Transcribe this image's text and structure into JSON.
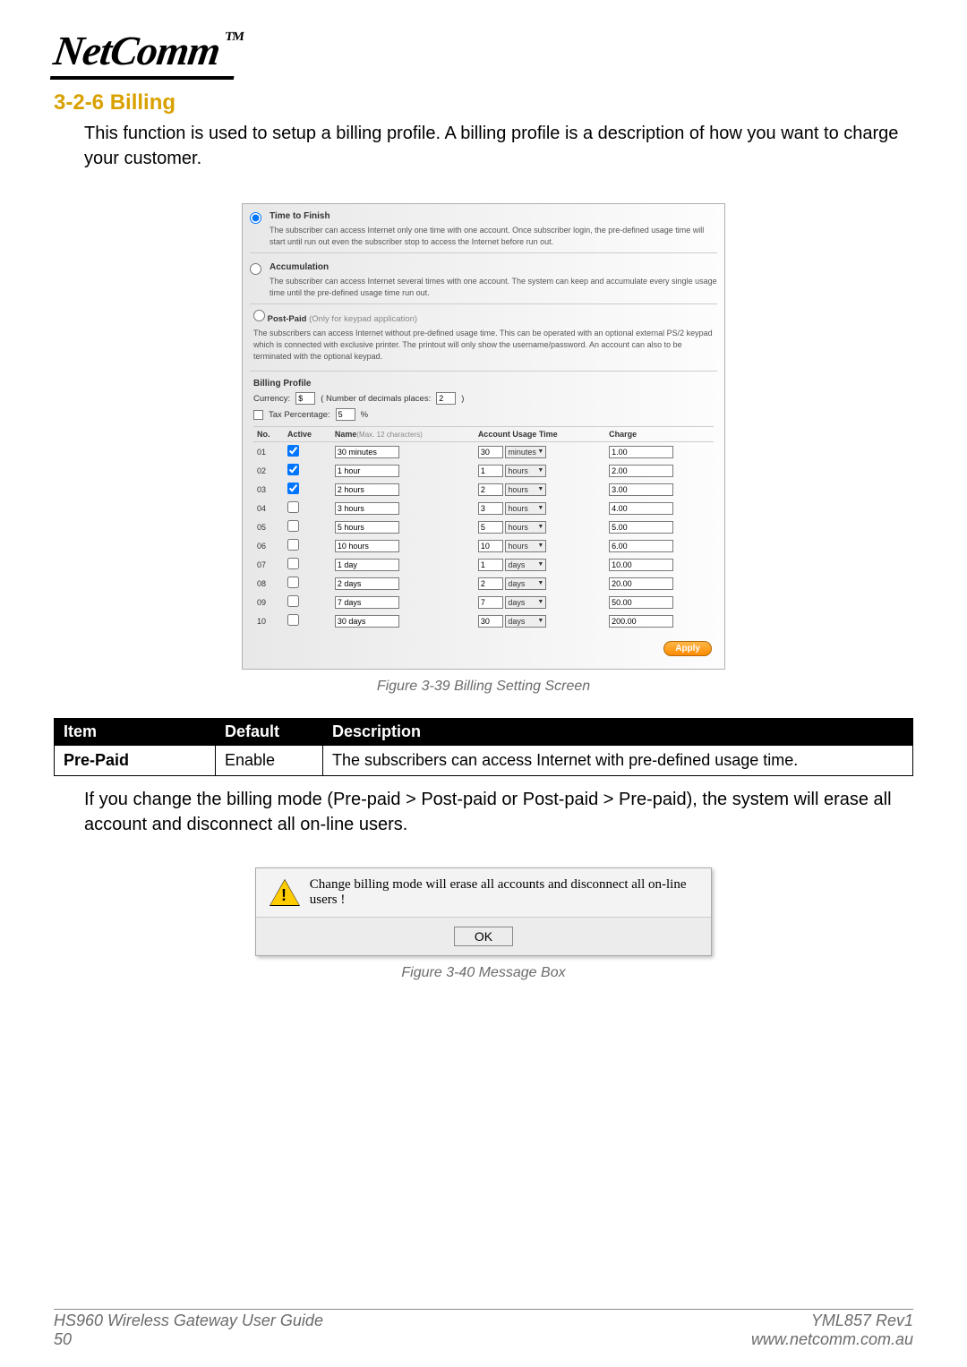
{
  "logo_text": "NetComm",
  "logo_tm": "TM",
  "section_title": "3-2-6 Billing",
  "intro": "This function is used to setup a billing profile. A billing profile is a description of how you want to charge your customer.",
  "modes": {
    "time_to_finish": {
      "title": "Time to Finish",
      "desc": "The subscriber can access Internet only one time with one account.  Once subscriber login, the pre-defined usage time will start until run out even the subscriber stop to access the Internet before run out."
    },
    "accumulation": {
      "title": "Accumulation",
      "desc": "The subscriber can access Internet several times with one account.  The system can keep and accumulate every single usage time until the pre-defined usage time run out."
    },
    "postpaid": {
      "title_prefix": "Post-Paid",
      "title_gray": "(Only for keypad application)",
      "desc": "The subscribers can access Internet without pre-defined usage time. This can be operated with an optional external PS/2 keypad which is connected with exclusive printer. The printout will only show the username/password. An account can also to be terminated with the optional keypad."
    }
  },
  "billing_profile_label": "Billing Profile",
  "currency_label": "Currency:",
  "currency_value": "$",
  "decimals_label": "( Number of decimals places:",
  "decimals_value": "2",
  "decimals_close": ")",
  "tax_label": "Tax Percentage:",
  "tax_value": "5",
  "tax_unit": "%",
  "table": {
    "headers": {
      "no": "No.",
      "active": "Active",
      "name": "Name",
      "name_hint": "(Max. 12 characters)",
      "usage": "Account Usage Time",
      "charge": "Charge"
    },
    "rows": [
      {
        "no": "01",
        "active": true,
        "name": "30 minutes",
        "qty": "30",
        "unit": "minutes",
        "charge": "1.00"
      },
      {
        "no": "02",
        "active": true,
        "name": "1 hour",
        "qty": "1",
        "unit": "hours",
        "charge": "2.00"
      },
      {
        "no": "03",
        "active": true,
        "name": "2 hours",
        "qty": "2",
        "unit": "hours",
        "charge": "3.00"
      },
      {
        "no": "04",
        "active": false,
        "name": "3 hours",
        "qty": "3",
        "unit": "hours",
        "charge": "4.00"
      },
      {
        "no": "05",
        "active": false,
        "name": "5 hours",
        "qty": "5",
        "unit": "hours",
        "charge": "5.00"
      },
      {
        "no": "06",
        "active": false,
        "name": "10 hours",
        "qty": "10",
        "unit": "hours",
        "charge": "6.00"
      },
      {
        "no": "07",
        "active": false,
        "name": "1 day",
        "qty": "1",
        "unit": "days",
        "charge": "10.00"
      },
      {
        "no": "08",
        "active": false,
        "name": "2 days",
        "qty": "2",
        "unit": "days",
        "charge": "20.00"
      },
      {
        "no": "09",
        "active": false,
        "name": "7 days",
        "qty": "7",
        "unit": "days",
        "charge": "50.00"
      },
      {
        "no": "10",
        "active": false,
        "name": "30 days",
        "qty": "30",
        "unit": "days",
        "charge": "200.00"
      }
    ]
  },
  "apply_label": "Apply",
  "caption1": "Figure 3-39 Billing Setting Screen",
  "desc_table": {
    "headers": {
      "item": "Item",
      "default": "Default",
      "description": "Description"
    },
    "row": {
      "item": "Pre-Paid",
      "default": "Enable",
      "description": "The subscribers can access Internet with pre-defined usage time."
    }
  },
  "note": "If you change the billing mode (Pre-paid > Post-paid or Post-paid > Pre-paid), the system will erase all account and disconnect all on-line users.",
  "msgbox": {
    "text": "Change billing mode will erase all accounts and disconnect all on-line users !",
    "ok": "OK"
  },
  "caption2": "Figure 3-40 Message Box",
  "footer": {
    "left1": "HS960 Wireless Gateway User Guide",
    "left2": "50",
    "right1": "YML857 Rev1",
    "right2": "www.netcomm.com.au"
  }
}
